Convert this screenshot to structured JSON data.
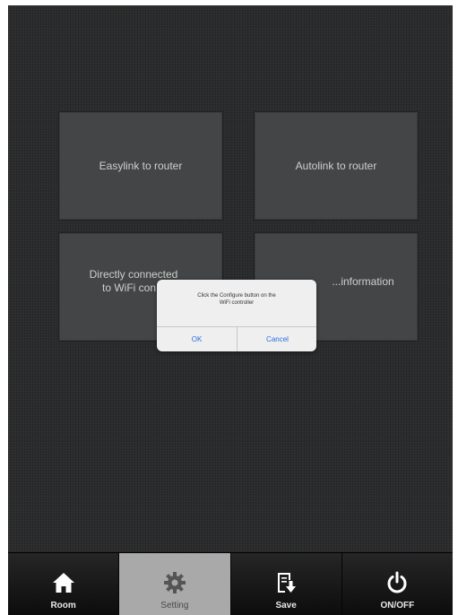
{
  "tiles": [
    {
      "label": "Easylink to router"
    },
    {
      "label": "Autolink to router"
    },
    {
      "label": "Directly connected\nto WiFi con..."
    },
    {
      "label": "...information"
    }
  ],
  "dialog": {
    "message": "Click the Configure button on the\nWiFi controller",
    "ok_label": "OK",
    "cancel_label": "Cancel"
  },
  "tabbar": {
    "items": [
      {
        "label": "Room",
        "icon": "home-icon",
        "active": false
      },
      {
        "label": "Setting",
        "icon": "gear-icon",
        "active": true
      },
      {
        "label": "Save",
        "icon": "save-icon",
        "active": false
      },
      {
        "label": "ON/OFF",
        "icon": "power-icon",
        "active": false
      }
    ]
  },
  "colors": {
    "background": "#2e2f30",
    "tile": "#484a4b",
    "active_tab": "#a9a9a9",
    "dialog_button": "#2a6fe0"
  }
}
